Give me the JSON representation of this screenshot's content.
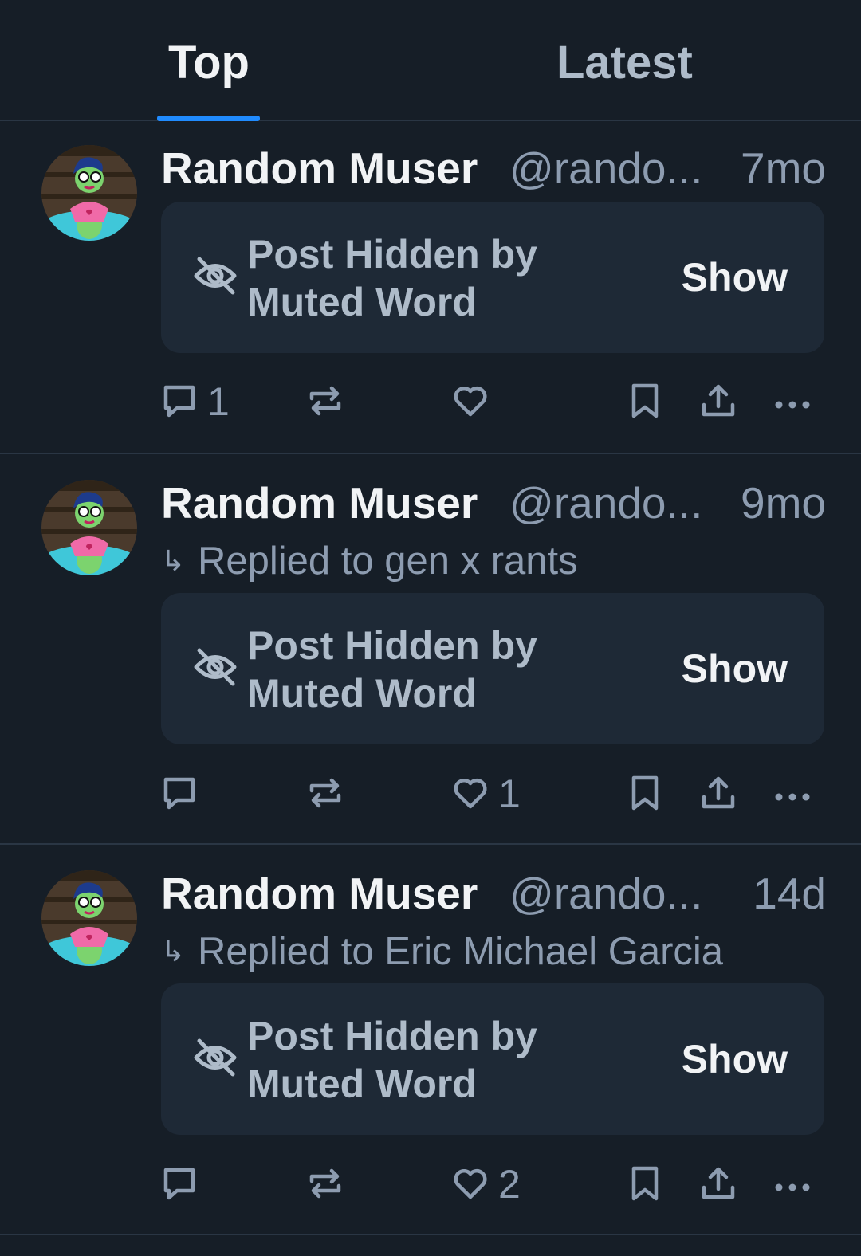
{
  "tabs": [
    {
      "label": "Top",
      "active": true
    },
    {
      "label": "Latest",
      "active": false
    }
  ],
  "colors": {
    "background": "#161e27",
    "hidden_box": "#1e2936",
    "accent": "#208bfe",
    "muted_text": "#8d9cb0"
  },
  "posts": [
    {
      "author": "Random Muser",
      "handle": "@rando...",
      "age": "7mo",
      "reply_to": null,
      "hidden_label": "Post Hidden by Muted Word",
      "show_label": "Show",
      "counts": {
        "replies": "1",
        "reposts": "",
        "likes": ""
      }
    },
    {
      "author": "Random Muser",
      "handle": "@rando...",
      "age": "9mo",
      "reply_to": "Replied to gen x rants",
      "hidden_label": "Post Hidden by Muted Word",
      "show_label": "Show",
      "counts": {
        "replies": "",
        "reposts": "",
        "likes": "1"
      }
    },
    {
      "author": "Random Muser",
      "handle": "@rando...",
      "age": "14d",
      "reply_to": "Replied to Eric Michael Garcia",
      "hidden_label": "Post Hidden by Muted Word",
      "show_label": "Show",
      "counts": {
        "replies": "",
        "reposts": "",
        "likes": "2"
      }
    }
  ],
  "icons": {
    "reply": "speech-bubble-icon",
    "repost": "repost-arrows-icon",
    "like": "heart-icon",
    "bookmark": "bookmark-icon",
    "share": "share-upload-icon",
    "more": "ellipsis-icon",
    "hidden": "eye-slash-icon"
  }
}
